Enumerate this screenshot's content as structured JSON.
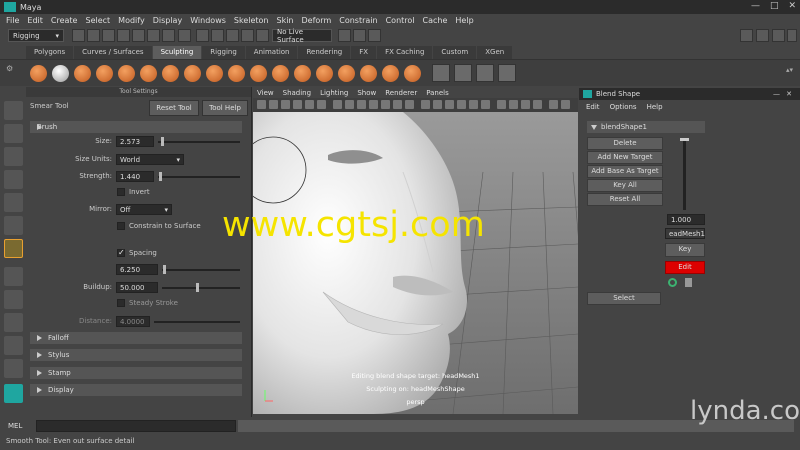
{
  "window": {
    "title": "Maya"
  },
  "menubar": [
    "File",
    "Edit",
    "Create",
    "Select",
    "Modify",
    "Display",
    "Windows",
    "Skeleton",
    "Skin",
    "Deform",
    "Constrain",
    "Control",
    "Cache",
    "Help"
  ],
  "statusline": {
    "menuset": "Rigging",
    "live_surface": "No Live Surface"
  },
  "shelf_tabs": [
    "Polygons",
    "Curves / Surfaces",
    "Sculpting",
    "Rigging",
    "Animation",
    "Rendering",
    "FX",
    "FX Caching",
    "Custom",
    "XGen"
  ],
  "active_shelf_tab": "Sculpting",
  "tool_settings": {
    "header": "Tool Settings",
    "tool_name": "Smear Tool",
    "reset_label": "Reset Tool",
    "help_label": "Tool Help",
    "brush_section": "Brush",
    "size_label": "Size:",
    "size_value": "2.573",
    "size_units_label": "Size Units:",
    "size_units_value": "World",
    "strength_label": "Strength:",
    "strength_value": "1.440",
    "invert_label": "Invert",
    "mirror_label": "Mirror:",
    "mirror_value": "Off",
    "constrain_label": "Constrain to Surface",
    "spacing_label": "Spacing",
    "spacing_value": "6.250",
    "buildup_label": "Buildup:",
    "buildup_value": "50.000",
    "steady_label": "Steady Stroke",
    "distance_label": "Distance:",
    "distance_value": "4.0000",
    "sections": [
      "Falloff",
      "Stylus",
      "Stamp",
      "Display"
    ]
  },
  "viewport": {
    "menu": [
      "View",
      "Shading",
      "Lighting",
      "Show",
      "Renderer",
      "Panels"
    ],
    "hud_line1": "Editing blend shape target: headMesh1",
    "hud_line2": "Sculpting on: headMeshShape",
    "camera": "persp"
  },
  "blend_shape": {
    "title": "Blend Shape",
    "menu": [
      "Edit",
      "Options",
      "Help"
    ],
    "node": "blendShape1",
    "buttons": [
      "Delete",
      "Add New Target",
      "Add Base As Target",
      "Key All",
      "Reset All"
    ],
    "weight_value": "1.000",
    "target_name": "eadMesh1",
    "key_label": "Key",
    "edit_label": "Edit",
    "select_label": "Select"
  },
  "command_line": {
    "label": "MEL"
  },
  "help_line": "Smooth Tool: Even out surface detail",
  "watermark": "www.cgtsj.com",
  "lynda": "lynda.com"
}
